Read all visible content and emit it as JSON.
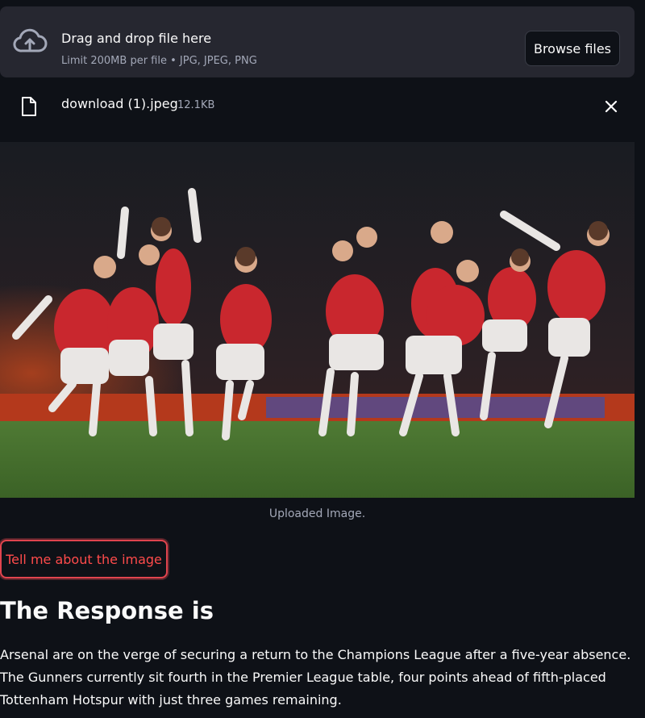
{
  "uploader": {
    "title": "Drag and drop file here",
    "limit_text": "Limit 200MB per file • JPG, JPEG, PNG",
    "browse_label": "Browse files",
    "icon": "cloud-upload-icon"
  },
  "file": {
    "name": "download (1).jpeg",
    "size": "12.1KB",
    "icon": "file-icon",
    "remove_icon": "close-icon"
  },
  "image": {
    "caption": "Uploaded Image."
  },
  "action": {
    "button_label": "Tell me about the image"
  },
  "response": {
    "heading": "The Response is",
    "text": "Arsenal are on the verge of securing a return to the Champions League after a five-year absence. The Gunners currently sit fourth in the Premier League table, four points ahead of fifth-placed Tottenham Hotspur with just three games remaining."
  },
  "colors": {
    "background": "#0e1117",
    "dropzone": "#262730",
    "accent": "#ff4b4b",
    "muted_text": "#a3a8b8"
  }
}
